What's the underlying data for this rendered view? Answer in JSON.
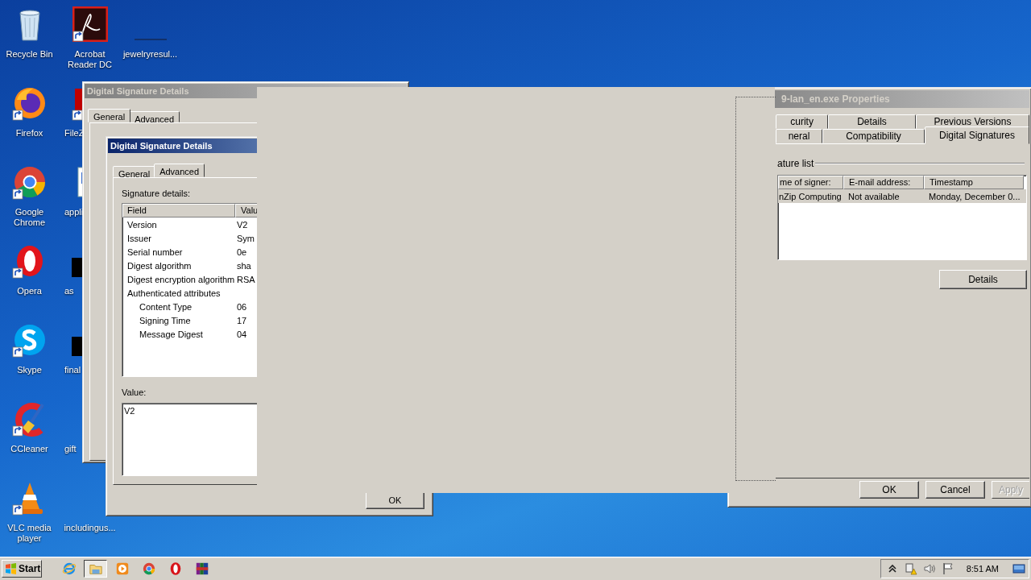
{
  "desktop": {
    "icons": [
      {
        "label": "Recycle Bin",
        "kind": "recycle",
        "shortcut": false
      },
      {
        "label": "Firefox",
        "kind": "firefox",
        "shortcut": true
      },
      {
        "label": "Google Chrome",
        "kind": "chrome",
        "shortcut": true
      },
      {
        "label": "Opera",
        "kind": "opera",
        "shortcut": true
      },
      {
        "label": "Skype",
        "kind": "skype",
        "shortcut": true
      },
      {
        "label": "CCleaner",
        "kind": "ccleaner",
        "shortcut": true
      },
      {
        "label": "VLC media player",
        "kind": "vlc",
        "shortcut": true
      },
      {
        "label": "Acrobat Reader DC",
        "kind": "acrobat",
        "shortcut": true
      },
      {
        "label": "FileZ",
        "kind": "filezilla",
        "shortcut": true
      },
      {
        "label": "appli",
        "kind": "app",
        "shortcut": false
      },
      {
        "label": "as",
        "kind": "black",
        "shortcut": false
      },
      {
        "label": "final",
        "kind": "black",
        "shortcut": false
      },
      {
        "label": "gift",
        "kind": "none",
        "shortcut": false
      },
      {
        "label": "includingus...",
        "kind": "none",
        "shortcut": false
      },
      {
        "label": "jewelryresul...",
        "kind": "blank",
        "shortcut": false
      }
    ]
  },
  "back_window": {
    "title": "Digital Signature Details",
    "active": false,
    "tabs": [
      {
        "label": "General",
        "selected": true
      },
      {
        "label": "Advanced",
        "selected": false
      }
    ]
  },
  "front_window": {
    "title": "Digital Signature Details",
    "active": true,
    "tabs": [
      {
        "label": "General",
        "selected": false
      },
      {
        "label": "Advanced",
        "selected": true
      }
    ],
    "details_label": "Signature details:",
    "columns": [
      "Field",
      "Valu"
    ],
    "rows": [
      {
        "field": "Version",
        "value": "V2"
      },
      {
        "field": "Issuer",
        "value": "Sym"
      },
      {
        "field": "Serial number",
        "value": "0e"
      },
      {
        "field": "Digest algorithm",
        "value": "sha"
      },
      {
        "field": "Digest encryption algorithm",
        "value": "RSA"
      },
      {
        "field": "Authenticated attributes",
        "children": [
          {
            "field": "Content Type",
            "value": "06"
          },
          {
            "field": "Signing Time",
            "value": "17"
          },
          {
            "field": "Message Digest",
            "value": "04"
          }
        ]
      }
    ],
    "value_label": "Value:",
    "value": "V2",
    "ok_button": "OK"
  },
  "properties_window": {
    "title": "9-lan_en.exe Properties",
    "active": false,
    "tab_rows": [
      [
        {
          "label": "curity",
          "selected": false
        },
        {
          "label": "Details",
          "selected": false
        },
        {
          "label": "Previous Versions",
          "selected": false
        }
      ],
      [
        {
          "label": "neral",
          "selected": false
        },
        {
          "label": "Compatibility",
          "selected": false
        },
        {
          "label": "Digital Signatures",
          "selected": true
        }
      ]
    ],
    "group_label": "ature list",
    "columns": [
      "me of signer:",
      "E-mail address:",
      "Timestamp"
    ],
    "rows": [
      {
        "cells": [
          "nZip Computing",
          "Not available",
          "Monday, December 0..."
        ],
        "selected": true
      }
    ],
    "details_button": "Details",
    "buttons": [
      {
        "label": "OK",
        "disabled": false
      },
      {
        "label": "Cancel",
        "disabled": false
      },
      {
        "label": "Apply",
        "disabled": true
      }
    ]
  },
  "taskbar": {
    "start": "Start",
    "apps": [
      {
        "kind": "ie",
        "active": false
      },
      {
        "kind": "explorer",
        "active": true
      },
      {
        "kind": "media",
        "active": false
      },
      {
        "kind": "chrome",
        "active": false
      },
      {
        "kind": "opera",
        "active": false
      },
      {
        "kind": "winrar",
        "active": false
      }
    ],
    "clock": "8:51 AM"
  }
}
